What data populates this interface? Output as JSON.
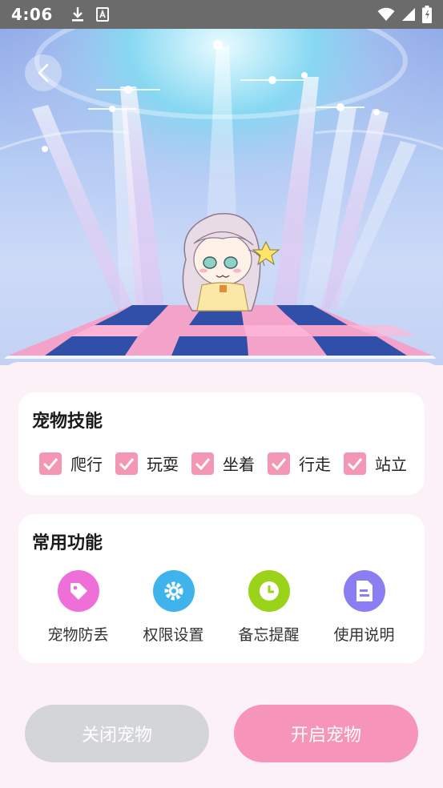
{
  "status_bar": {
    "time": "4:06"
  },
  "skills": {
    "title": "宠物技能",
    "items": [
      {
        "label": "爬行",
        "checked": true
      },
      {
        "label": "玩耍",
        "checked": true
      },
      {
        "label": "坐着",
        "checked": true
      },
      {
        "label": "行走",
        "checked": true
      },
      {
        "label": "站立",
        "checked": true
      }
    ]
  },
  "functions": {
    "title": "常用功能",
    "items": [
      {
        "label": "宠物防丢",
        "icon": "tag-icon",
        "color": "#ef6fd8"
      },
      {
        "label": "权限设置",
        "icon": "gear-icon",
        "color": "#3fb3ec"
      },
      {
        "label": "备忘提醒",
        "icon": "clock-icon",
        "color": "#9bd31a"
      },
      {
        "label": "使用说明",
        "icon": "document-icon",
        "color": "#8a7ef2"
      }
    ]
  },
  "buttons": {
    "close_label": "关闭宠物",
    "open_label": "开启宠物"
  },
  "colors": {
    "accent": "#f695b7",
    "disabled": "#d4d5d8",
    "panel_bg": "#fbf1f6"
  }
}
